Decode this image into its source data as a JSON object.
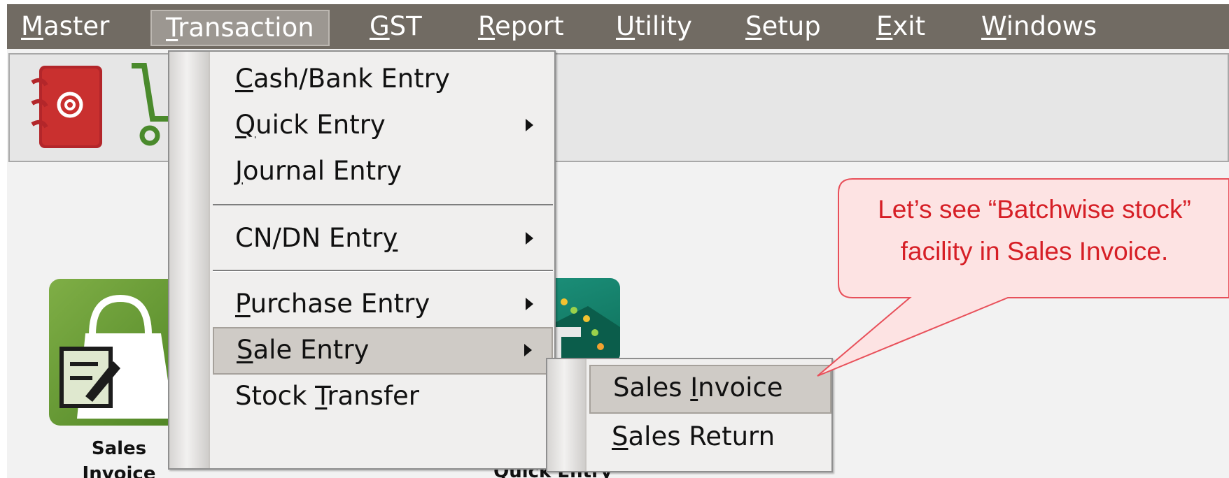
{
  "menubar": {
    "items": [
      {
        "hot": "M",
        "rest": "aster"
      },
      {
        "hot": "T",
        "rest": "ransaction"
      },
      {
        "hot": "G",
        "rest": "ST"
      },
      {
        "hot": "R",
        "rest": "eport"
      },
      {
        "hot": "U",
        "rest": "tility"
      },
      {
        "hot": "S",
        "rest": "etup"
      },
      {
        "hot": "E",
        "rest": "xit"
      },
      {
        "hot": "W",
        "rest": "indows"
      }
    ],
    "active_item": "Transaction"
  },
  "toolbar": {
    "icons": [
      "contacts-book-icon",
      "shopping-cart-icon"
    ]
  },
  "transaction_menu": {
    "cash_bank": {
      "hot": "C",
      "rest": "ash/Bank Entry"
    },
    "quick": {
      "hot": "Q",
      "rest": "uick Entry"
    },
    "journal": {
      "hot": "J",
      "rest": "ournal Entry"
    },
    "cndn": {
      "pre": "CN/DN Entr",
      "hot": "y",
      "rest": ""
    },
    "purchase": {
      "hot": "P",
      "rest": "urchase Entry"
    },
    "sale": {
      "hot": "S",
      "rest": "ale Entry"
    },
    "stock": {
      "pre": "Stock ",
      "hot": "T",
      "rest": "ransfer"
    },
    "highlighted": "Sale Entry"
  },
  "sale_submenu": {
    "invoice": {
      "pre": "Sales ",
      "hot": "I",
      "rest": "nvoice"
    },
    "return": {
      "hot": "S",
      "rest": "ales Return"
    },
    "highlighted": "Sales Invoice"
  },
  "desktop": {
    "sales_invoice_label_line1": "Sales",
    "sales_invoice_label_line2": "Invoice",
    "quick_entry_label": "Quick Entry"
  },
  "callout": {
    "line1": "Let’s see “Batchwise stock”",
    "line2": "facility in Sales Invoice.",
    "text_color": "#d61f26",
    "fill_color": "#fde3e3"
  },
  "colors": {
    "menubar": "#716b63",
    "menu_highlight": "#cfcbc6"
  }
}
